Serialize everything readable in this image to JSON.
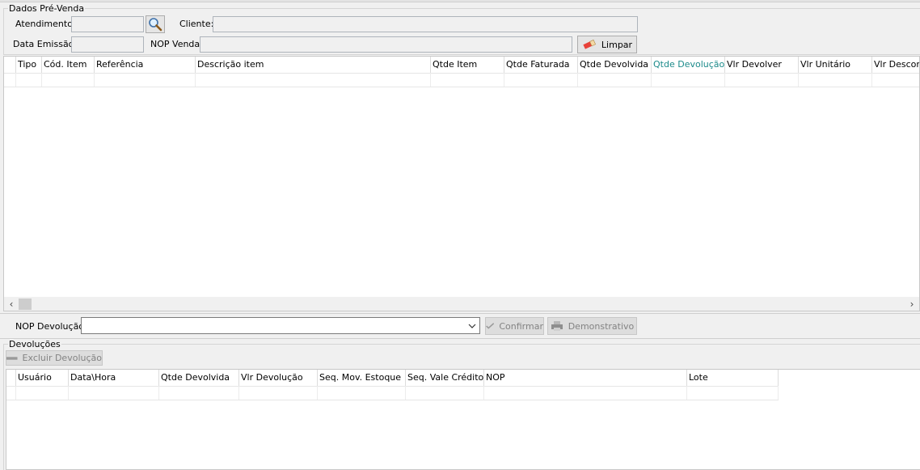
{
  "pre_venda": {
    "title": "Dados Pré-Venda",
    "atendimento_label": "Atendimento:",
    "atendimento_value": "",
    "cliente_label": "Cliente:",
    "cliente_value": "",
    "data_emissao_label": "Data Emissão:",
    "data_emissao_value": "",
    "nop_venda_label": "NOP Venda:",
    "nop_venda_value": "",
    "limpar_label": "Limpar"
  },
  "items_grid": {
    "columns": [
      "Tipo",
      "Cód. Item",
      "Referência",
      "Descrição item",
      "Qtde Item",
      "Qtde Faturada",
      "Qtde Devolvida",
      "Qtde Devolução",
      "Vlr Devolver",
      "Vlr Unitário",
      "Vlr Descont"
    ],
    "active_column": "Qtde Devolução",
    "active_color": "#1b8a8a"
  },
  "devolucao_bar": {
    "nop_label": "NOP Devolução:",
    "nop_value": "",
    "confirmar_label": "Confirmar",
    "demonstrativo_label": "Demonstrativo"
  },
  "devolucoes": {
    "title": "Devoluções",
    "excluir_label": "Excluir Devolução",
    "columns": [
      "Usuário",
      "Data\\Hora",
      "Qtde Devolvida",
      "Vlr Devolução",
      "Seq. Mov. Estoque",
      "Seq. Vale Crédito",
      "NOP",
      "Lote"
    ]
  },
  "icons": {
    "search": "magnifier-icon",
    "limpar": "eraser-icon",
    "confirmar": "checkmark-icon",
    "demonstrativo": "printer-icon",
    "excluir": "minus-icon"
  }
}
